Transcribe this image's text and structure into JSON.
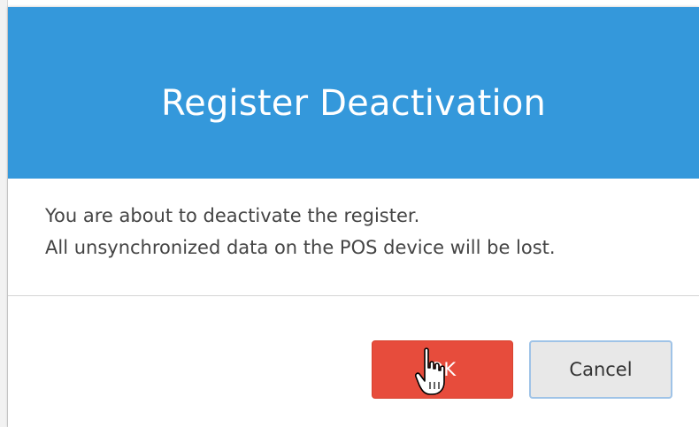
{
  "dialog": {
    "title": "Register Deactivation",
    "message_line_1": "You are about to deactivate the register.",
    "message_line_2": "All unsynchronized data on the POS device will be lost.",
    "ok_label": "OK",
    "cancel_label": "Cancel"
  },
  "colors": {
    "header": "#3498db",
    "ok_button": "#e74c3c",
    "cancel_button": "#e8e8e8"
  },
  "cursor": {
    "icon": "hand-pointer-icon"
  }
}
